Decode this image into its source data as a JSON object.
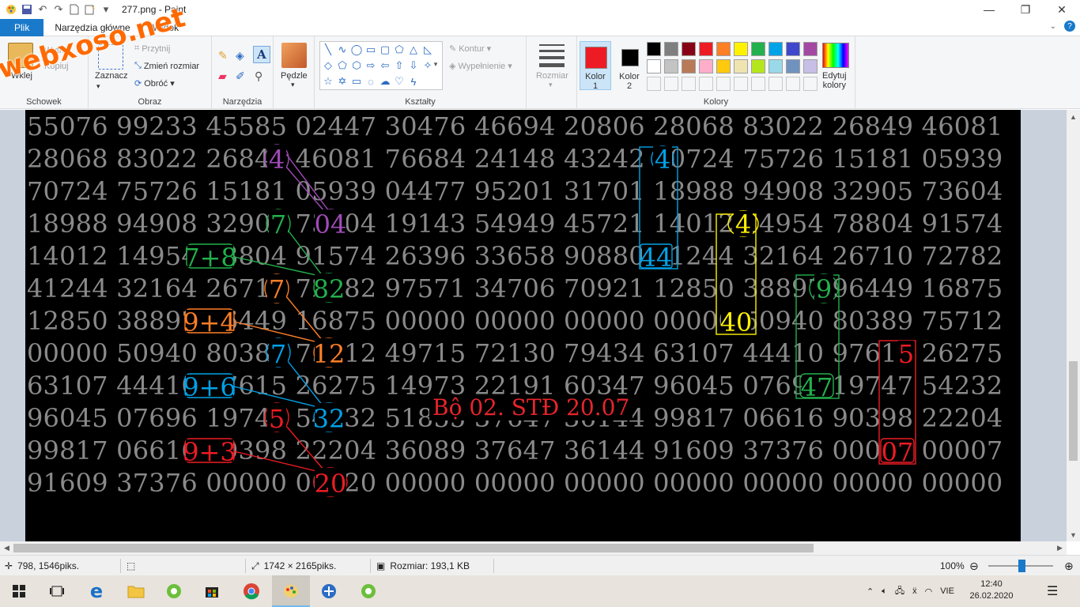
{
  "window": {
    "title": "277.png - Paint",
    "controls": {
      "minimize": "—",
      "maximize": "❐",
      "close": "✕"
    }
  },
  "tabs": [
    {
      "label": "Plik"
    },
    {
      "label": "Narzędzia główne"
    },
    {
      "label": "Widok"
    }
  ],
  "watermark": "webxoso.net",
  "ribbon": {
    "clipboard": {
      "paste": "Wklej",
      "cut": "Wytnij",
      "copy": "Kopiuj",
      "label": "Schowek"
    },
    "image": {
      "select": "Zaznacz",
      "crop": "Przytnij",
      "resize": "Zmień rozmiar",
      "rotate": "Obróć",
      "label": "Obraz"
    },
    "tools": {
      "label": "Narzędzia"
    },
    "brushes": {
      "label": "Pędzle"
    },
    "shapes": {
      "outline": "Kontur",
      "fill": "Wypełnienie",
      "label": "Kształty"
    },
    "size": {
      "label": "Rozmiar"
    },
    "color1": {
      "label": "Kolor",
      "num": "1",
      "value": "#ed1c24"
    },
    "color2": {
      "label": "Kolor",
      "num": "2",
      "value": "#000000"
    },
    "edit_colors": {
      "label1": "Edytuj",
      "label2": "kolory"
    },
    "colors_label": "Kolory",
    "palette": [
      "#000000",
      "#7f7f7f",
      "#880015",
      "#ed1c24",
      "#ff7f27",
      "#fff200",
      "#22b14c",
      "#00a2e8",
      "#3f48cc",
      "#a349a4",
      "#ffffff",
      "#c3c3c3",
      "#b97a57",
      "#ffaec9",
      "#ffc90e",
      "#efe4b0",
      "#b5e61d",
      "#99d9ea",
      "#7092be",
      "#c8bfe7"
    ]
  },
  "canvas": {
    "rows": [
      "55076 99233 45585 02447 30476 46694 20806 28068 83022 26849 46081",
      "28068 83022 26849 46081 76684 24148 43242 70724 75726 15181 05939",
      "70724 75726 15181 05939 04477 95201 31701 18988 94908 32905 73604",
      "18988 94908 32905 73604 19143 54949 45721 14012 14954 78804 91574",
      "14012 14954 78804 91574 26396 33658 90880 41244 32164 26710 72782",
      "41244 32164 26710 72782 97571 34706 70921 12850 38897 96449 16875",
      "12850 38897 96449 16875 00000 00000 00000 00000 50940 80389 75712",
      "00000 50940 80389 75712 49715 72130 79434 63107 44410 97615 26275",
      "63107 44410 97615 26275 14973 22191 60347 96045 07696 19747 54232",
      "96045 07696 19747 54232 51855 37647 36144 99817 06616 90398 22204",
      "99817 06616 90398 22204 36089 37647 36144 91609 37376 00000 00007",
      "91609 37376 00000 00020 00000 00000 00000 00000 00000 00000 00000"
    ],
    "caption": "Bộ 02. STĐ 20.07",
    "annotations": {
      "purple1": "4",
      "purple2": "04",
      "green1": "7",
      "green_sum": "7+8",
      "green2": "82",
      "orange1": "7",
      "orange_sum": "9+4",
      "orange2": "12",
      "blue1": "7",
      "blue_sum": "9+6",
      "blue2": "32",
      "red1": "5",
      "red_sum": "9+3",
      "red2": "20",
      "blue_col1": "4",
      "blue_col2": "44",
      "yellow1": "4",
      "yellow2": "40",
      "green_col1": "9",
      "green_col2": "47",
      "red_col1": "5",
      "red_col2": "07"
    }
  },
  "status": {
    "cursor": "798, 1546piks.",
    "size": "1742 × 2165piks.",
    "filesize": "Rozmiar: 193,1 KB",
    "zoom": "100%"
  },
  "taskbar": {
    "lang": "VIE",
    "time": "12:40",
    "date": "26.02.2020"
  }
}
